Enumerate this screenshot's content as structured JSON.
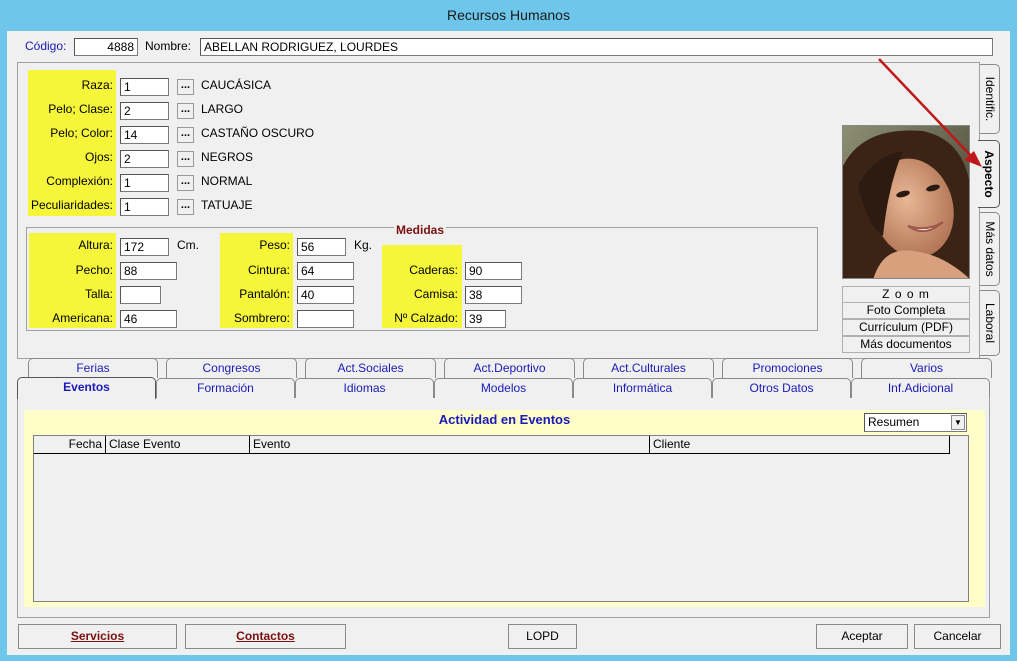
{
  "window": {
    "title": "Recursos Humanos"
  },
  "header": {
    "codigo_label": "Código:",
    "codigo_value": "4888",
    "nombre_label": "Nombre:",
    "nombre_value": "ABELLAN RODRIGUEZ, LOURDES"
  },
  "aspecto": {
    "rows": [
      {
        "label": "Raza:",
        "value": "1",
        "desc": "CAUCÁSICA"
      },
      {
        "label": "Pelo; Clase:",
        "value": "2",
        "desc": "LARGO"
      },
      {
        "label": "Pelo; Color:",
        "value": "14",
        "desc": "CASTAÑO OSCURO"
      },
      {
        "label": "Ojos:",
        "value": "2",
        "desc": "NEGROS"
      },
      {
        "label": "Complexión:",
        "value": "1",
        "desc": "NORMAL"
      },
      {
        "label": "Peculiaridades:",
        "value": "1",
        "desc": "TATUAJE"
      }
    ],
    "ellipsis": "..."
  },
  "medidas": {
    "title": "Medidas",
    "altura_label": "Altura:",
    "altura": "172",
    "altura_unit": "Cm.",
    "pecho_label": "Pecho:",
    "pecho": "88",
    "talla_label": "Talla:",
    "talla": "",
    "americana_label": "Americana:",
    "americana": "46",
    "peso_label": "Peso:",
    "peso": "56",
    "peso_unit": "Kg.",
    "cintura_label": "Cintura:",
    "cintura": "64",
    "pantalon_label": "Pantalón:",
    "pantalon": "40",
    "sombrero_label": "Sombrero:",
    "sombrero": "",
    "caderas_label": "Caderas:",
    "caderas": "90",
    "camisa_label": "Camisa:",
    "camisa": "38",
    "calzado_label": "Nº Calzado:",
    "calzado": "39"
  },
  "photo_buttons": {
    "zoom": "Z o o m",
    "foto": "Foto Completa",
    "curriculum": "Currículum (PDF)",
    "docs": "Más documentos"
  },
  "side_tabs": {
    "identific": "Identific.",
    "aspecto": "Aspecto",
    "mas_datos": "Más datos",
    "laboral": "Laboral"
  },
  "tabs_row1": [
    "Ferias",
    "Congresos",
    "Act.Sociales",
    "Act.Deportivo",
    "Act.Culturales",
    "Promociones",
    "Varios"
  ],
  "tabs_row2": [
    "Eventos",
    "Formación",
    "Idiomas",
    "Modelos",
    "Informática",
    "Otros Datos",
    "Inf.Adicional"
  ],
  "eventos": {
    "title": "Actividad en Eventos",
    "select_value": "Resumen",
    "columns": [
      "Fecha",
      "Clase Evento",
      "Evento",
      "Cliente"
    ]
  },
  "footer": {
    "servicios": "Servicios",
    "contactos": "Contactos",
    "lopd": "LOPD",
    "aceptar": "Aceptar",
    "cancelar": "Cancelar"
  },
  "colors": {
    "title_bar": "#6ec6ea",
    "highlight": "#f5f53a",
    "panel_bg": "#fffec8",
    "tab_text": "#1a1ab8",
    "arrow": "#c0181a"
  }
}
